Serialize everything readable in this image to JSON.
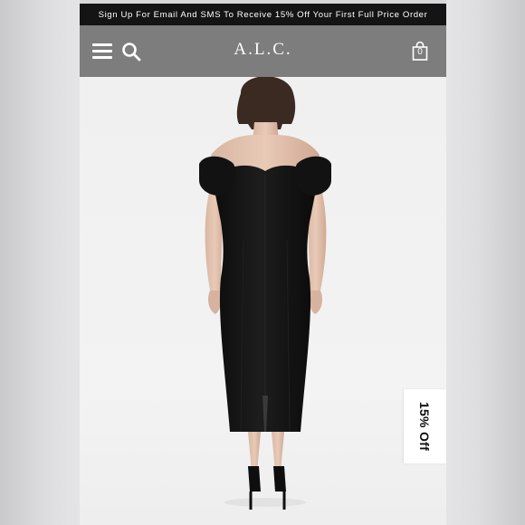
{
  "promo_banner": {
    "text": "Sign Up For Email And SMS To Receive 15% Off Your First Full Price Order"
  },
  "header": {
    "brand": "A.L.C.",
    "menu_icon": "hamburger-menu-icon",
    "search_icon": "search-icon",
    "bag_icon": "shopping-bag-icon",
    "bag_count": "0"
  },
  "product": {
    "image": "model-black-off-shoulder-midi-dress-back-view"
  },
  "discount_tab": {
    "label": "15% Off"
  },
  "colors": {
    "promo_bg": "#141414",
    "nav_bg": "#7d7d7d",
    "page_bg": "#efefef",
    "dress": "#141414"
  }
}
